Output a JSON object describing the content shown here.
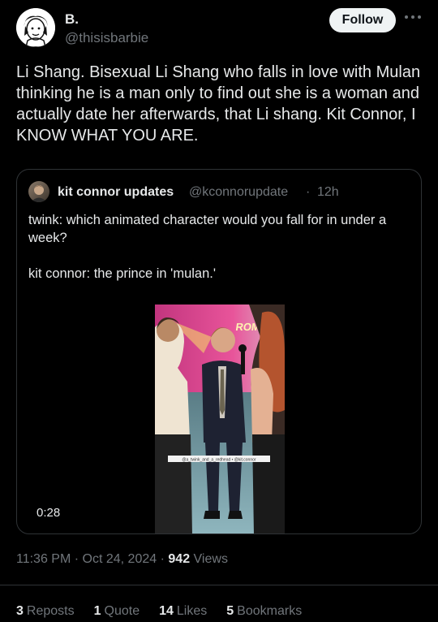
{
  "author": {
    "name": "B.",
    "handle": "@thisisbarbie"
  },
  "follow_label": "Follow",
  "tweet_text": "Li Shang. Bisexual Li Shang who falls in love with Mulan thinking he is a man only to find out she is a woman and actually date her afterwards, that Li shang. Kit Connor, I KNOW WHAT YOU ARE.",
  "quote": {
    "name": "kit connor updates",
    "handle": "@kconnorupdate",
    "separator": "·",
    "time": "12h",
    "text": "twink: which animated character would you fall for in under a week?\n\nkit connor: the prince in 'mulan.'",
    "video_duration": "0:28",
    "video_sign_text": "ROMEO",
    "video_caption": "@a_twink_and_a_redhead • @kit.connor"
  },
  "meta": {
    "time": "11:36 PM",
    "separator": "·",
    "date": "Oct 24, 2024",
    "views_count": "942",
    "views_label": "Views"
  },
  "stats": {
    "reposts": {
      "count": "3",
      "label": "Reposts"
    },
    "quotes": {
      "count": "1",
      "label": "Quote"
    },
    "likes": {
      "count": "14",
      "label": "Likes"
    },
    "bookmarks": {
      "count": "5",
      "label": "Bookmarks"
    }
  },
  "icons": {
    "more": "more-horizontal-icon",
    "avatar": "cartoon-avatar-icon"
  }
}
